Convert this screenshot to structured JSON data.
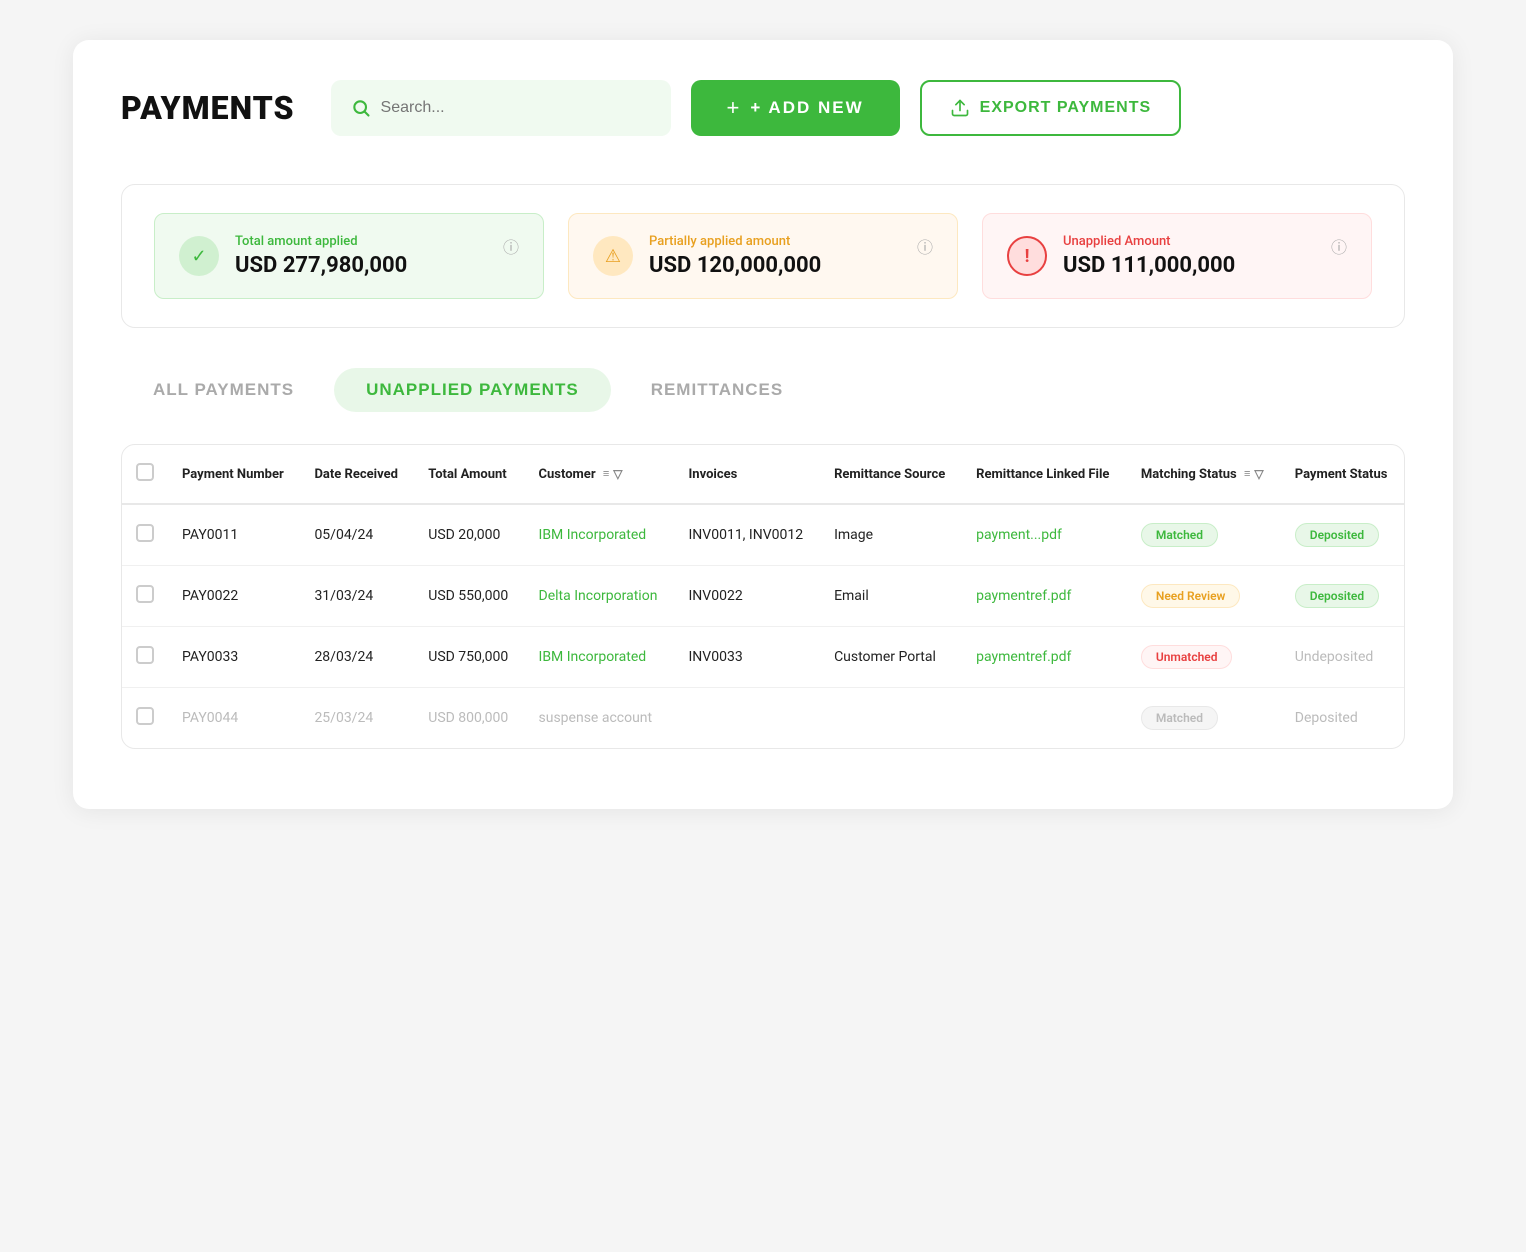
{
  "page": {
    "title": "PAYMENTS"
  },
  "header": {
    "search_placeholder": "Search...",
    "add_new_label": "+ ADD NEW",
    "export_label": "⊙ EXPORT PAYMENTS"
  },
  "summary": {
    "cards": [
      {
        "id": "total-applied",
        "label": "Total amount applied",
        "amount": "USD 277,980,000",
        "type": "green",
        "icon": "✓"
      },
      {
        "id": "partially-applied",
        "label": "Partially applied amount",
        "amount": "USD 120,000,000",
        "type": "orange",
        "icon": "⚠"
      },
      {
        "id": "unapplied",
        "label": "Unapplied Amount",
        "amount": "USD 111,000,000",
        "type": "red",
        "icon": "!"
      }
    ]
  },
  "tabs": [
    {
      "id": "all-payments",
      "label": "ALL PAYMENTS",
      "active": false
    },
    {
      "id": "unapplied-payments",
      "label": "UNAPPLIED PAYMENTS",
      "active": true
    },
    {
      "id": "remittances",
      "label": "REMITTANCES",
      "active": false
    }
  ],
  "table": {
    "columns": [
      {
        "id": "checkbox",
        "label": ""
      },
      {
        "id": "payment-number",
        "label": "Payment Number"
      },
      {
        "id": "date-received",
        "label": "Date Received"
      },
      {
        "id": "total-amount",
        "label": "Total Amount"
      },
      {
        "id": "customer",
        "label": "Customer",
        "filterable": true,
        "sortable": true
      },
      {
        "id": "invoices",
        "label": "Invoices"
      },
      {
        "id": "remittance-source",
        "label": "Remittance Source"
      },
      {
        "id": "remittance-linked-file",
        "label": "Remittance Linked File"
      },
      {
        "id": "matching-status",
        "label": "Matching Status",
        "filterable": true,
        "sortable": true
      },
      {
        "id": "payment-status",
        "label": "Payment Status"
      }
    ],
    "rows": [
      {
        "id": "row-1",
        "dim": false,
        "payment_number": "PAY0011",
        "date_received": "05/04/24",
        "total_amount": "USD 20,000",
        "customer": "IBM Incorporated",
        "customer_link": true,
        "invoices": "INV0011, INV0012",
        "remittance_source": "Image",
        "remittance_linked_file": "payment...pdf",
        "matching_status": "Matched",
        "matching_badge": "matched",
        "payment_status": "Deposited",
        "payment_badge": "deposited"
      },
      {
        "id": "row-2",
        "dim": false,
        "payment_number": "PAY0022",
        "date_received": "31/03/24",
        "total_amount": "USD 550,000",
        "customer": "Delta Incorporation",
        "customer_link": true,
        "invoices": "INV0022",
        "remittance_source": "Email",
        "remittance_linked_file": "paymentref.pdf",
        "matching_status": "Need Review",
        "matching_badge": "need-review",
        "payment_status": "Deposited",
        "payment_badge": "deposited"
      },
      {
        "id": "row-3",
        "dim": false,
        "payment_number": "PAY0033",
        "date_received": "28/03/24",
        "total_amount": "USD 750,000",
        "customer": "IBM Incorporated",
        "customer_link": true,
        "invoices": "INV0033",
        "remittance_source": "Customer Portal",
        "remittance_linked_file": "paymentref.pdf",
        "matching_status": "Unmatched",
        "matching_badge": "unmatched",
        "payment_status": "Undeposited",
        "payment_badge": "undeposited"
      },
      {
        "id": "row-4",
        "dim": true,
        "payment_number": "PAY0044",
        "date_received": "25/03/24",
        "total_amount": "USD 800,000",
        "customer": "suspense account",
        "customer_link": false,
        "invoices": "",
        "remittance_source": "",
        "remittance_linked_file": "",
        "matching_status": "Matched",
        "matching_badge": "matched-dim",
        "payment_status": "Deposited",
        "payment_badge": "deposited-dim"
      }
    ]
  }
}
